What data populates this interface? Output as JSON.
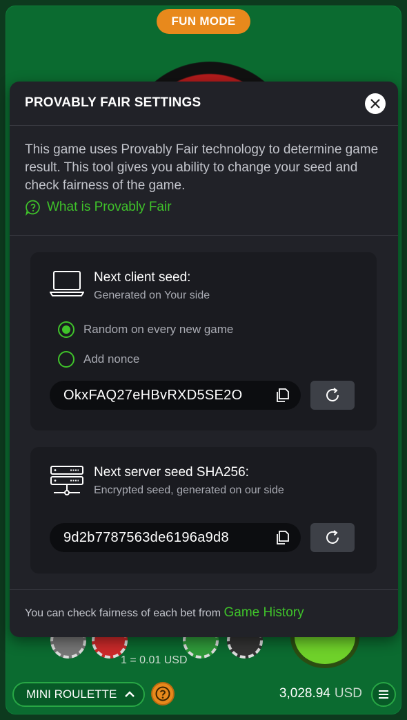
{
  "top": {
    "fun_mode": "FUN MODE"
  },
  "modal": {
    "title": "PROVABLY FAIR SETTINGS",
    "intro": "This game uses Provably Fair technology to determine game result. This tool gives you ability to change your seed and check fairness of the game.",
    "what_is_link": "What is Provably Fair",
    "client": {
      "title": "Next client seed:",
      "subtitle": "Generated on Your side",
      "options": [
        "Random on every new game",
        "Add nonce"
      ],
      "selected_option": "Random on every new game",
      "seed": "OkxFAQ27eHBvRXD5SE2O"
    },
    "server": {
      "title": "Next server seed SHA256:",
      "subtitle": "Encrypted seed, generated on our side",
      "seed": "9d2b7787563de6196a9d8"
    },
    "footer_text": "You can check fairness of each bet from",
    "footer_link": "Game History"
  },
  "game": {
    "rate": "1 = 0.01 USD",
    "game_name": "MINI ROULETTE",
    "balance": "3,028.94",
    "currency": "USD"
  },
  "colors": {
    "accent_green": "#3fc32a",
    "orange": "#e8891c",
    "modal_bg": "#212228"
  }
}
